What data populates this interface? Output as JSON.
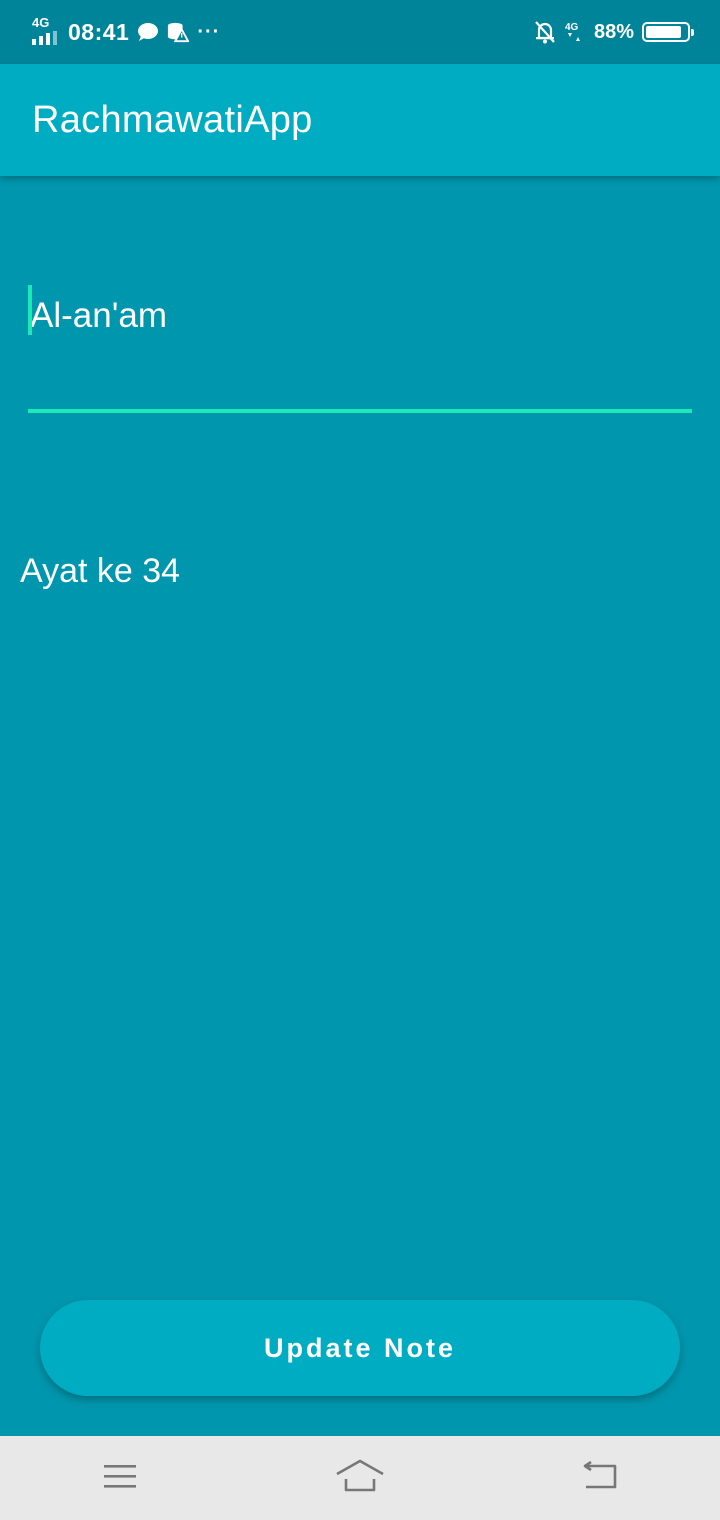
{
  "status_bar": {
    "network_label": "4G",
    "time": "08:41",
    "more": "···",
    "network_label_right": "4G",
    "battery_percent": "88%",
    "battery_level": 0.88
  },
  "app_bar": {
    "title": "RachmawatiApp"
  },
  "form": {
    "title_value": "Al-an'am",
    "description_value": "Ayat ke 34"
  },
  "actions": {
    "update_label": "Update Note"
  },
  "colors": {
    "background": "#0096ad",
    "app_bar": "#00acc1",
    "status_bar": "#00849a",
    "accent": "#1de9b6",
    "nav_bar": "#e8e8e8"
  }
}
